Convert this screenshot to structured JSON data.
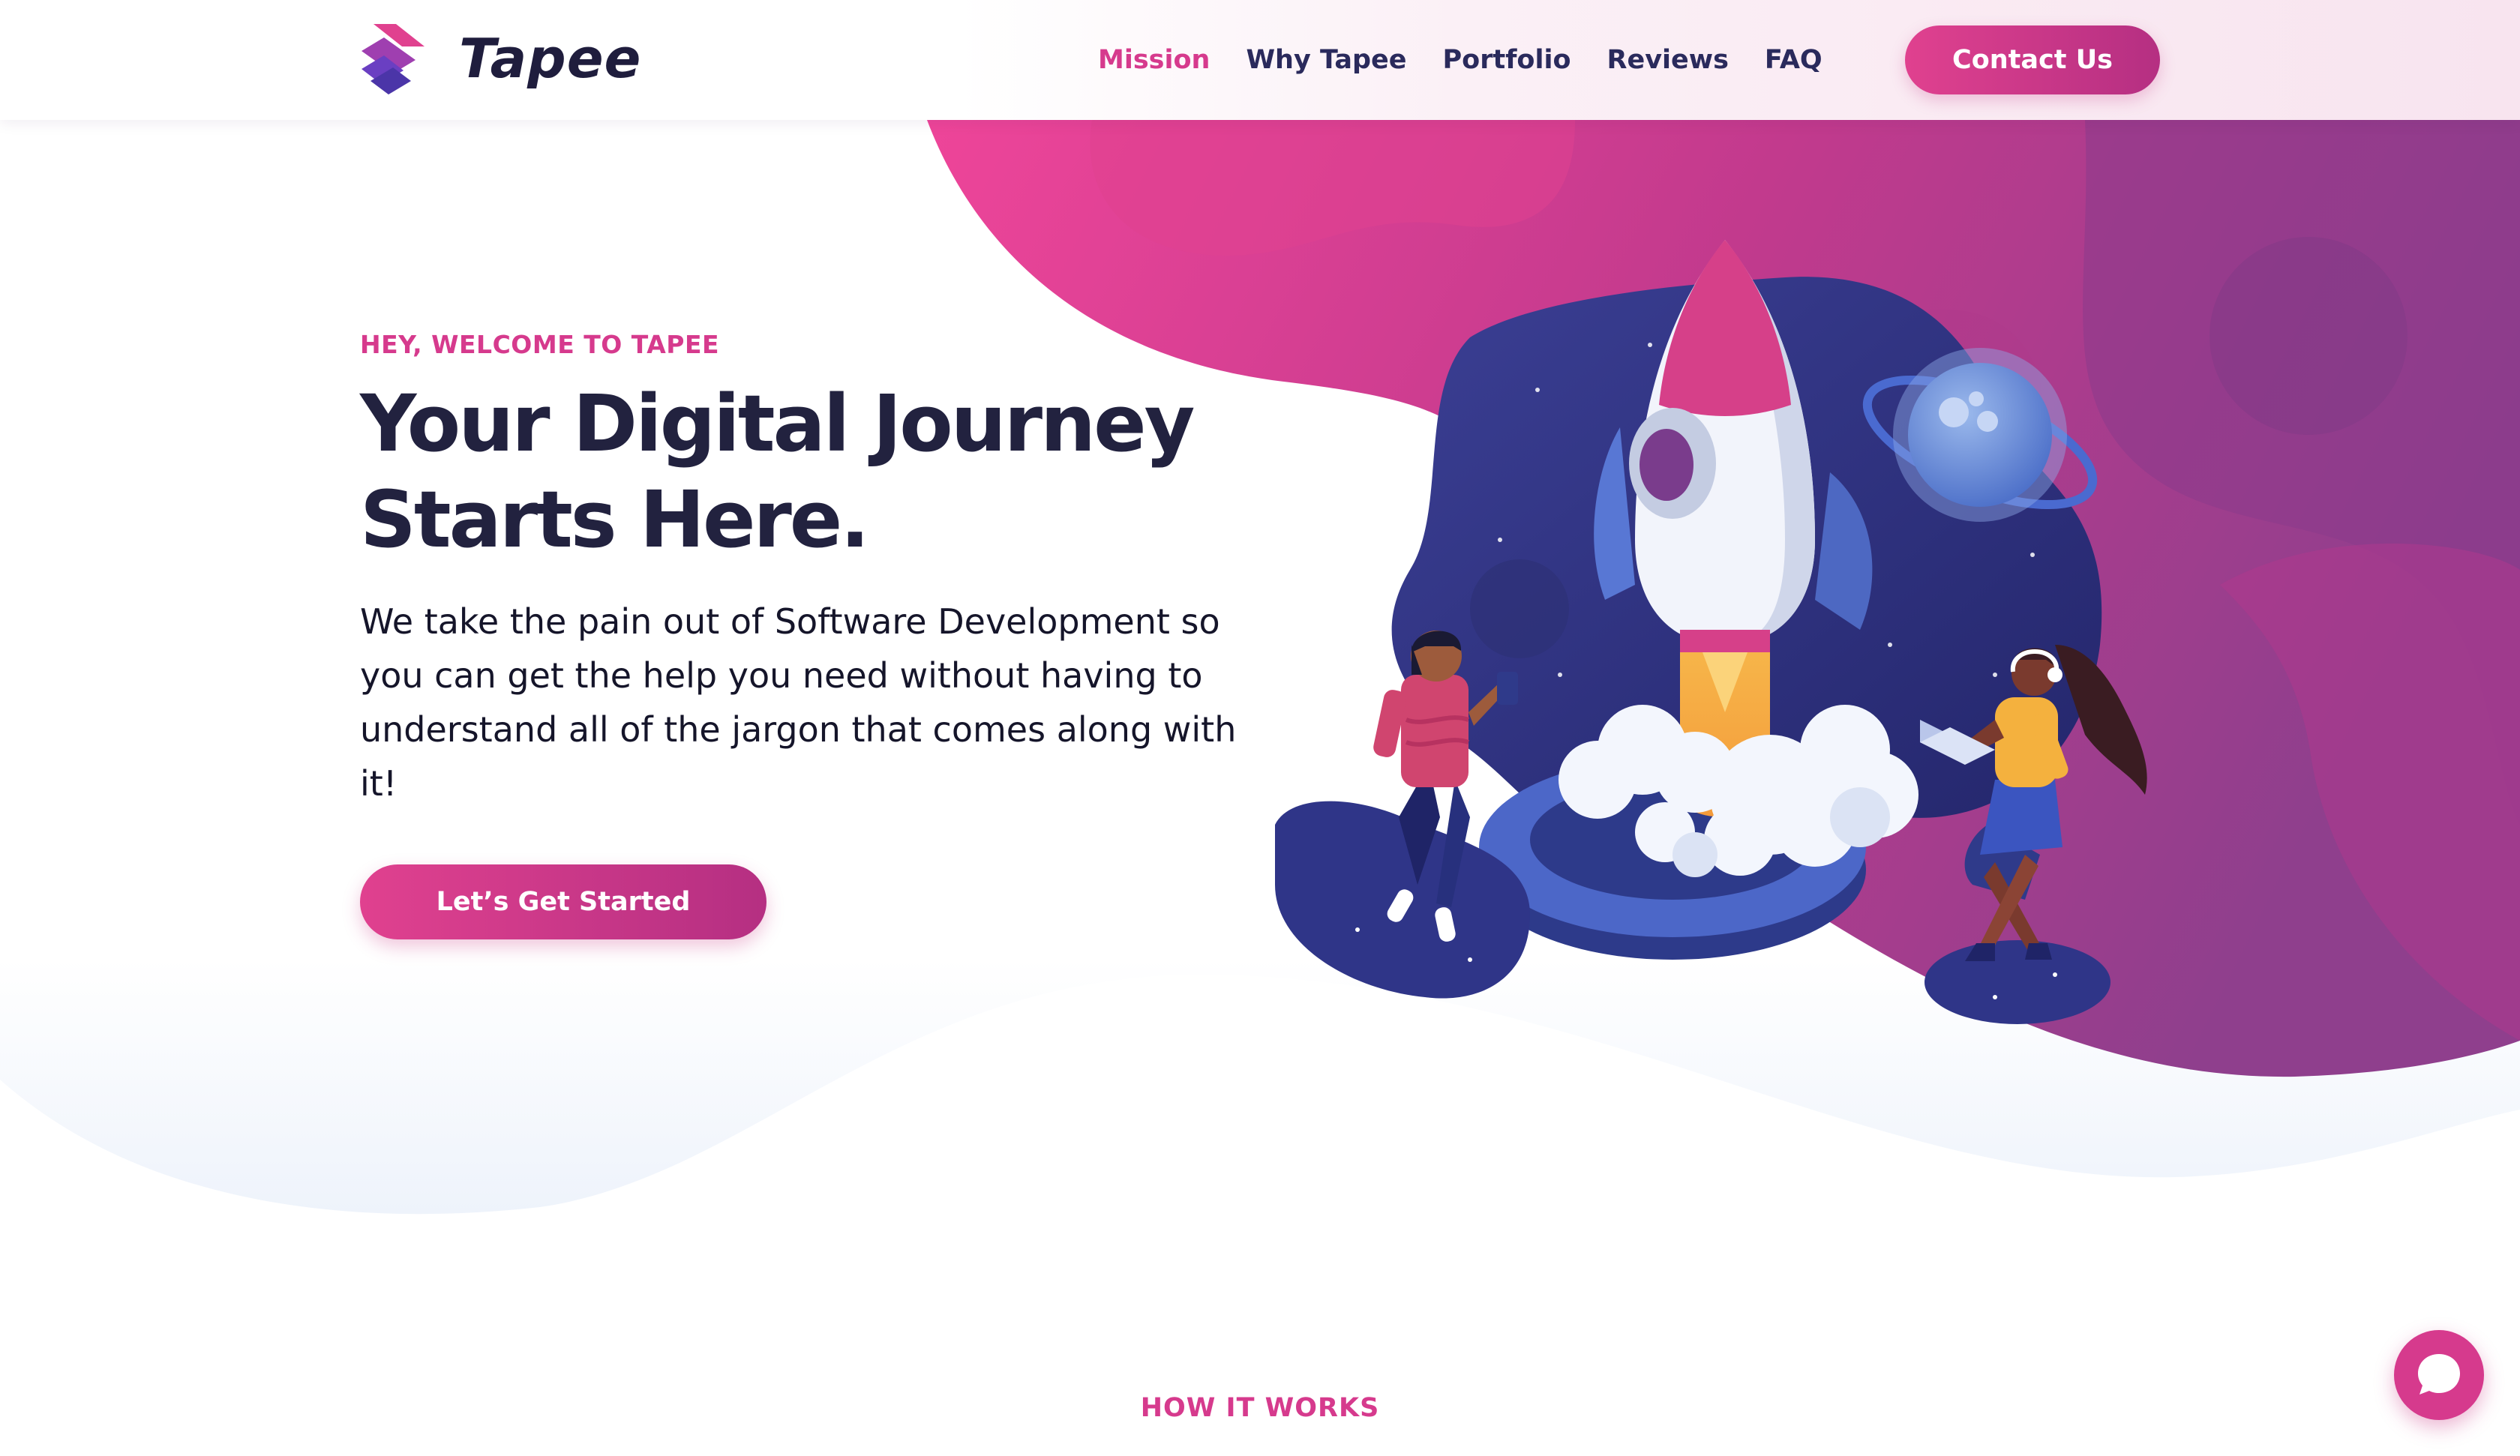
{
  "brand": {
    "name": "Tapee"
  },
  "nav": {
    "items": [
      {
        "label": "Mission",
        "active": true
      },
      {
        "label": "Why Tapee",
        "active": false
      },
      {
        "label": "Portfolio",
        "active": false
      },
      {
        "label": "Reviews",
        "active": false
      },
      {
        "label": "FAQ",
        "active": false
      }
    ],
    "contact_label": "Contact Us"
  },
  "hero": {
    "eyebrow": "HEY, WELCOME TO TAPEE",
    "headline_line1": "Your Digital Journey",
    "headline_line2": "Starts Here.",
    "subtext": "We take the pain out of Software Development so you can get the help you need without having to understand all of the jargon that comes along with it!",
    "cta_label": "Let’s Get Started"
  },
  "how_it_works": {
    "label": "HOW IT WORKS"
  },
  "icons": {
    "logo": "tapee-logo-icon",
    "chat": "chat-bubble-icon",
    "illustration": "rocket-launch-illustration"
  },
  "colors": {
    "accent_pink": "#d63a8d",
    "accent_purple": "#8c3e8c",
    "navy": "#22223f",
    "nav_text": "#2a2a5c"
  }
}
